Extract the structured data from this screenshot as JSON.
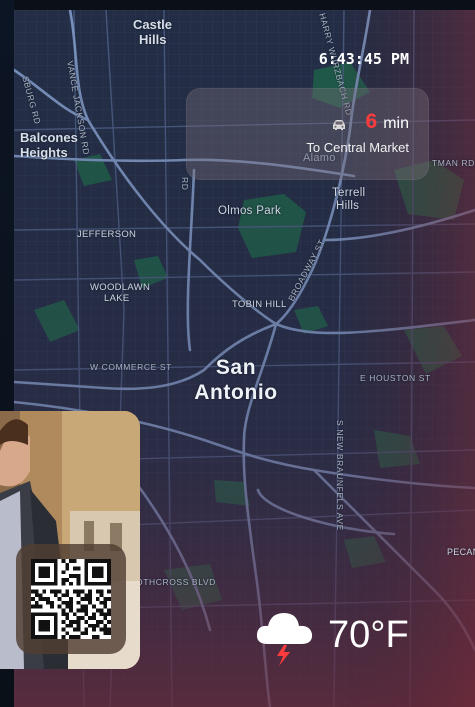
{
  "clock": {
    "time": "6:43:45 PM"
  },
  "navigation": {
    "eta_value": "6",
    "eta_unit": "min",
    "destination": "To Central Market",
    "icon": "car-icon"
  },
  "map": {
    "city_name_line1": "San",
    "city_name_line2": "Antonio",
    "neighborhoods": {
      "castle_hills_1": "Castle",
      "castle_hills_2": "Hills",
      "balcones_1": "Balcones",
      "balcones_2": "Heights",
      "olmos_park": "Olmos Park",
      "terrell_1": "Terrell",
      "terrell_2": "Hills",
      "jefferson": "JEFFERSON",
      "woodlawn_1": "WOODLAWN",
      "woodlawn_2": "LAKE",
      "tobin_hill": "TOBIN HILL",
      "alamo": "Alamo",
      "pecan": "PECAN"
    },
    "streets": {
      "vance_jackson": "VANCE JACKSON RD",
      "w_commerce": "W COMMERCE ST",
      "e_houston": "E HOUSTON ST",
      "broadway": "BROADWAY ST",
      "new_braunfels": "S NEW BRAUNFELS AVE",
      "southcross": "OTHCROSS BLVD",
      "fredericksburg": "SBURG RD",
      "harry_wurzbach": "HARRY WURZBACH RD",
      "rd_vertical": "RD",
      "rd_side": "RD",
      "sidman": "TMAN RD"
    }
  },
  "weather": {
    "temperature": "70°F",
    "icon": "thunderstorm-cloud-icon"
  },
  "widgets": {
    "photo": "person-photo",
    "qr": "qr-code-icon"
  },
  "colors": {
    "eta_accent": "#ff3b3b",
    "map_base": "#26304a",
    "park_green": "#1f6a4e",
    "road": "#6f86b0"
  }
}
